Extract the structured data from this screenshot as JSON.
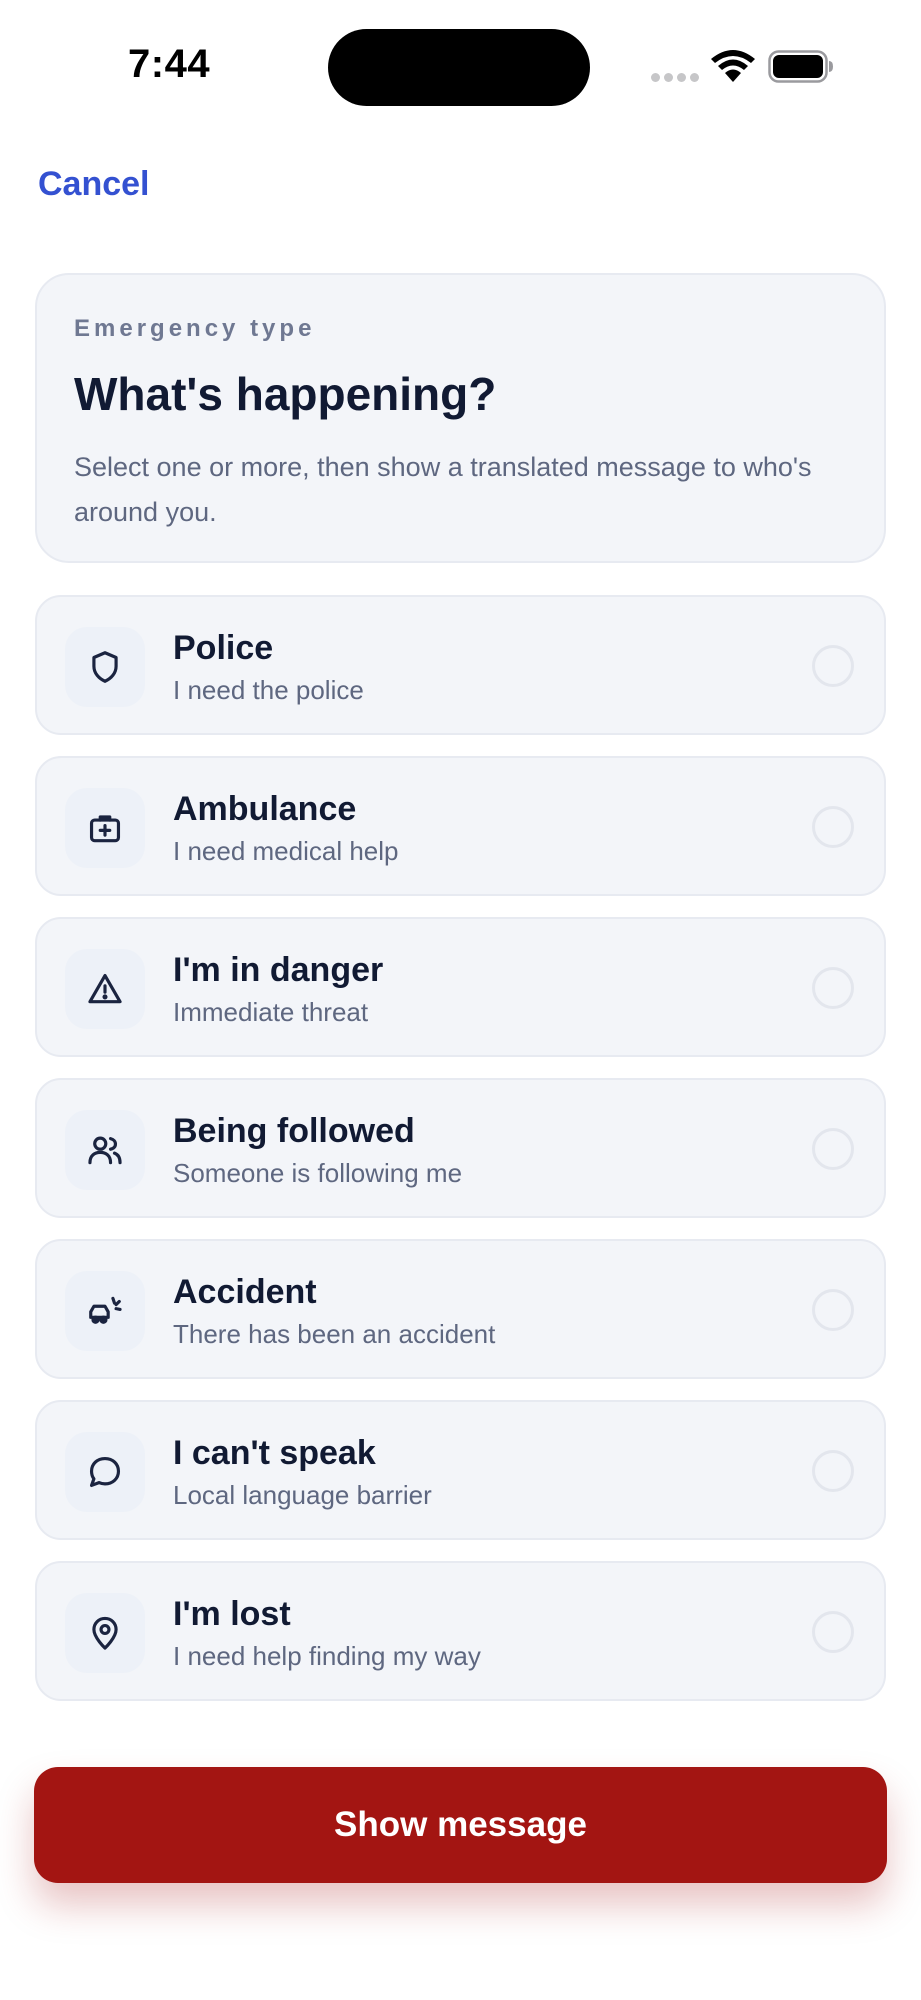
{
  "status_bar": {
    "time": "7:44",
    "icons": [
      "signal-dots-icon",
      "wifi-icon",
      "battery-icon"
    ]
  },
  "nav": {
    "cancel_label": "Cancel"
  },
  "header": {
    "eyebrow": "Emergency type",
    "title": "What's happening?",
    "subtitle": "Select one or more, then show a translated message to who's around you."
  },
  "options": [
    {
      "icon": "shield-icon",
      "title": "Police",
      "subtitle": "I need the police",
      "selected": false
    },
    {
      "icon": "medical-kit-icon",
      "title": "Ambulance",
      "subtitle": "I need medical help",
      "selected": false
    },
    {
      "icon": "warning-triangle-icon",
      "title": "I'm in danger",
      "subtitle": "Immediate threat",
      "selected": false
    },
    {
      "icon": "users-icon",
      "title": "Being followed",
      "subtitle": "Someone is following me",
      "selected": false
    },
    {
      "icon": "car-crash-icon",
      "title": "Accident",
      "subtitle": "There has been an accident",
      "selected": false
    },
    {
      "icon": "speech-bubble-icon",
      "title": "I can't speak",
      "subtitle": "Local language barrier",
      "selected": false
    },
    {
      "icon": "map-pin-icon",
      "title": "I'm lost",
      "subtitle": "I need help finding my way",
      "selected": false
    }
  ],
  "cta": {
    "label": "Show message"
  },
  "colors": {
    "accent": "#3451d1",
    "danger": "#a31512",
    "card_bg": "#f3f5f9",
    "text_primary": "#111a33",
    "text_secondary": "#5e6780"
  }
}
